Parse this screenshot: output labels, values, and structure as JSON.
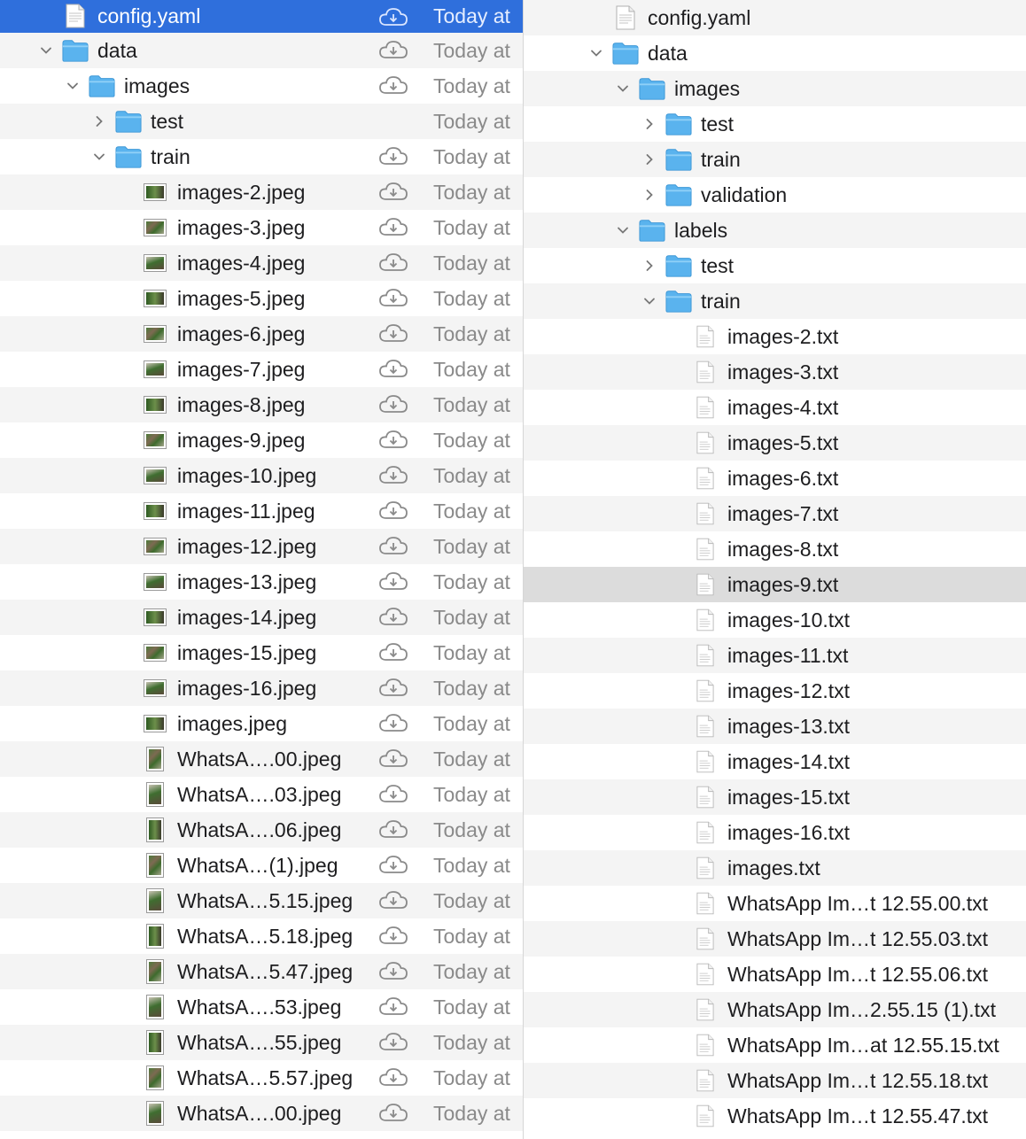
{
  "colors": {
    "selection": "#2f6fdc",
    "folder": "#5ab3ee",
    "date_text": "#8a8a8a",
    "hover_row": "#dcdcdc"
  },
  "left_pane": {
    "date_label": "Today at",
    "rows": [
      {
        "name": "config.yaml",
        "kind": "doc",
        "indent": 0,
        "chevron": "none",
        "cloud": true,
        "selected": true
      },
      {
        "name": "data",
        "kind": "folder",
        "indent": 0,
        "chevron": "down",
        "cloud": true
      },
      {
        "name": "images",
        "kind": "folder",
        "indent": 1,
        "chevron": "down",
        "cloud": true
      },
      {
        "name": "test",
        "kind": "folder",
        "indent": 2,
        "chevron": "right",
        "cloud": false
      },
      {
        "name": "train",
        "kind": "folder",
        "indent": 2,
        "chevron": "down",
        "cloud": true
      },
      {
        "name": "images-2.jpeg",
        "kind": "image",
        "indent": 3,
        "cloud": true
      },
      {
        "name": "images-3.jpeg",
        "kind": "image",
        "indent": 3,
        "cloud": true
      },
      {
        "name": "images-4.jpeg",
        "kind": "image",
        "indent": 3,
        "cloud": true
      },
      {
        "name": "images-5.jpeg",
        "kind": "image",
        "indent": 3,
        "cloud": true
      },
      {
        "name": "images-6.jpeg",
        "kind": "image",
        "indent": 3,
        "cloud": true
      },
      {
        "name": "images-7.jpeg",
        "kind": "image",
        "indent": 3,
        "cloud": true
      },
      {
        "name": "images-8.jpeg",
        "kind": "image",
        "indent": 3,
        "cloud": true
      },
      {
        "name": "images-9.jpeg",
        "kind": "image",
        "indent": 3,
        "cloud": true
      },
      {
        "name": "images-10.jpeg",
        "kind": "image",
        "indent": 3,
        "cloud": true
      },
      {
        "name": "images-11.jpeg",
        "kind": "image",
        "indent": 3,
        "cloud": true
      },
      {
        "name": "images-12.jpeg",
        "kind": "image",
        "indent": 3,
        "cloud": true
      },
      {
        "name": "images-13.jpeg",
        "kind": "image",
        "indent": 3,
        "cloud": true
      },
      {
        "name": "images-14.jpeg",
        "kind": "image",
        "indent": 3,
        "cloud": true
      },
      {
        "name": "images-15.jpeg",
        "kind": "image",
        "indent": 3,
        "cloud": true
      },
      {
        "name": "images-16.jpeg",
        "kind": "image",
        "indent": 3,
        "cloud": true
      },
      {
        "name": "images.jpeg",
        "kind": "image",
        "indent": 3,
        "cloud": true
      },
      {
        "name": "WhatsA….00.jpeg",
        "kind": "image-tall",
        "indent": 3,
        "cloud": true
      },
      {
        "name": "WhatsA….03.jpeg",
        "kind": "image-tall",
        "indent": 3,
        "cloud": true
      },
      {
        "name": "WhatsA….06.jpeg",
        "kind": "image-tall",
        "indent": 3,
        "cloud": true
      },
      {
        "name": "WhatsA…(1).jpeg",
        "kind": "image-tall",
        "indent": 3,
        "cloud": true
      },
      {
        "name": "WhatsA…5.15.jpeg",
        "kind": "image-tall",
        "indent": 3,
        "cloud": true
      },
      {
        "name": "WhatsA…5.18.jpeg",
        "kind": "image-tall",
        "indent": 3,
        "cloud": true
      },
      {
        "name": "WhatsA…5.47.jpeg",
        "kind": "image-tall",
        "indent": 3,
        "cloud": true
      },
      {
        "name": "WhatsA….53.jpeg",
        "kind": "image-tall",
        "indent": 3,
        "cloud": true
      },
      {
        "name": "WhatsA….55.jpeg",
        "kind": "image-tall",
        "indent": 3,
        "cloud": true
      },
      {
        "name": "WhatsA…5.57.jpeg",
        "kind": "image-tall",
        "indent": 3,
        "cloud": true
      },
      {
        "name": "WhatsA….00.jpeg",
        "kind": "image-tall",
        "indent": 3,
        "cloud": true
      }
    ]
  },
  "right_pane": {
    "rows": [
      {
        "name": "config.yaml",
        "kind": "doc",
        "indent": 0,
        "chevron": "none"
      },
      {
        "name": "data",
        "kind": "folder",
        "indent": 0,
        "chevron": "down"
      },
      {
        "name": "images",
        "kind": "folder",
        "indent": 1,
        "chevron": "down"
      },
      {
        "name": "test",
        "kind": "folder",
        "indent": 2,
        "chevron": "right"
      },
      {
        "name": "train",
        "kind": "folder",
        "indent": 2,
        "chevron": "right"
      },
      {
        "name": "validation",
        "kind": "folder",
        "indent": 2,
        "chevron": "right"
      },
      {
        "name": "labels",
        "kind": "folder",
        "indent": 1,
        "chevron": "down"
      },
      {
        "name": "test",
        "kind": "folder",
        "indent": 2,
        "chevron": "right"
      },
      {
        "name": "train",
        "kind": "folder",
        "indent": 2,
        "chevron": "down"
      },
      {
        "name": "images-2.txt",
        "kind": "txt",
        "indent": 3
      },
      {
        "name": "images-3.txt",
        "kind": "txt",
        "indent": 3
      },
      {
        "name": "images-4.txt",
        "kind": "txt",
        "indent": 3
      },
      {
        "name": "images-5.txt",
        "kind": "txt",
        "indent": 3
      },
      {
        "name": "images-6.txt",
        "kind": "txt",
        "indent": 3
      },
      {
        "name": "images-7.txt",
        "kind": "txt",
        "indent": 3
      },
      {
        "name": "images-8.txt",
        "kind": "txt",
        "indent": 3
      },
      {
        "name": "images-9.txt",
        "kind": "txt",
        "indent": 3,
        "hover": true
      },
      {
        "name": "images-10.txt",
        "kind": "txt",
        "indent": 3
      },
      {
        "name": "images-11.txt",
        "kind": "txt",
        "indent": 3
      },
      {
        "name": "images-12.txt",
        "kind": "txt",
        "indent": 3
      },
      {
        "name": "images-13.txt",
        "kind": "txt",
        "indent": 3
      },
      {
        "name": "images-14.txt",
        "kind": "txt",
        "indent": 3
      },
      {
        "name": "images-15.txt",
        "kind": "txt",
        "indent": 3
      },
      {
        "name": "images-16.txt",
        "kind": "txt",
        "indent": 3
      },
      {
        "name": "images.txt",
        "kind": "txt",
        "indent": 3
      },
      {
        "name": "WhatsApp Im…t 12.55.00.txt",
        "kind": "txt",
        "indent": 3
      },
      {
        "name": "WhatsApp Im…t 12.55.03.txt",
        "kind": "txt",
        "indent": 3
      },
      {
        "name": "WhatsApp Im…t 12.55.06.txt",
        "kind": "txt",
        "indent": 3
      },
      {
        "name": "WhatsApp Im…2.55.15 (1).txt",
        "kind": "txt",
        "indent": 3
      },
      {
        "name": "WhatsApp Im…at 12.55.15.txt",
        "kind": "txt",
        "indent": 3
      },
      {
        "name": "WhatsApp Im…t 12.55.18.txt",
        "kind": "txt",
        "indent": 3
      },
      {
        "name": "WhatsApp Im…t 12.55.47.txt",
        "kind": "txt",
        "indent": 3
      }
    ]
  }
}
